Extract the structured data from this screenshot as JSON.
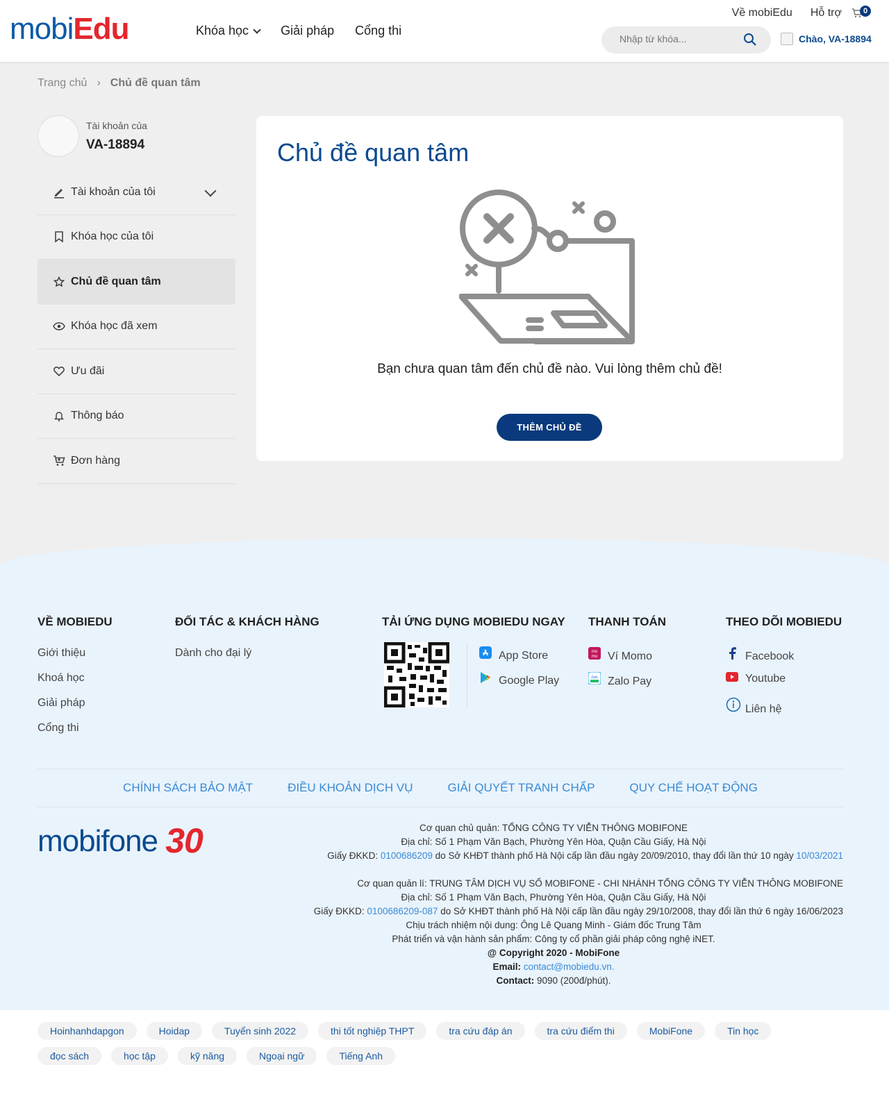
{
  "header": {
    "logo_text_a": "mobi",
    "logo_text_b": "Edu",
    "nav": [
      "Khóa học",
      "Giải pháp",
      "Cổng thi"
    ],
    "top_links": [
      "Về mobiEdu",
      "Hỗ trợ"
    ],
    "cart_count": "0",
    "search_placeholder": "Nhập từ khóa...",
    "greeting": "Chào, VA-18894"
  },
  "breadcrumb": {
    "home": "Trang chủ",
    "current": "Chủ đề quan tâm"
  },
  "profile": {
    "label": "Tài khoản của",
    "name": "VA-18894"
  },
  "menu": [
    {
      "label": "Tài khoản của tôi",
      "icon": "pencil-icon"
    },
    {
      "label": "Khóa học của tôi",
      "icon": "bookmark-icon"
    },
    {
      "label": "Chủ đề quan tâm",
      "icon": "star-icon"
    },
    {
      "label": "Khóa học đã xem",
      "icon": "eye-icon"
    },
    {
      "label": "Ưu đãi",
      "icon": "heart-icon"
    },
    {
      "label": "Thông báo",
      "icon": "bell-icon"
    },
    {
      "label": "Đơn hàng",
      "icon": "cart-icon"
    }
  ],
  "main": {
    "title": "Chủ đề quan tâm",
    "empty_message": "Bạn chưa quan tâm đến chủ đề nào. Vui lòng thêm chủ đề!",
    "button": "THÊM CHỦ ĐỀ"
  },
  "footer": {
    "col1": {
      "title": "VỀ MOBIEDU",
      "links": [
        "Giới thiệu",
        "Khoá học",
        "Giải pháp",
        "Cổng thi"
      ]
    },
    "col2": {
      "title": "ĐỐI TÁC & KHÁCH HÀNG",
      "links": [
        "Dành cho đại lý"
      ]
    },
    "col3": {
      "title": "TẢI ỨNG DỤNG MOBIEDU NGAY",
      "links": [
        "App Store",
        "Google Play"
      ]
    },
    "col4": {
      "title": "THANH TOÁN",
      "links": [
        "Ví Momo",
        "Zalo Pay"
      ]
    },
    "col5": {
      "title": "THEO DÕI MOBIEDU",
      "links": [
        "Facebook",
        "Youtube",
        "Liên hệ"
      ]
    },
    "policies": [
      "CHÍNH SÁCH BẢO MẬT",
      "ĐIỀU KHOẢN DỊCH VỤ",
      "GIẢI QUYẾT TRANH CHẤP",
      "QUY CHẾ HOẠT ĐỘNG"
    ],
    "mf_logo": "mobifone",
    "mf_30": "30",
    "legal": {
      "l1": "Cơ quan chủ quản: TỔNG CÔNG TY VIỄN THÔNG MOBIFONE",
      "l2": "Địa chỉ: Số 1 Phạm Văn Bạch, Phường Yên Hòa, Quận Cầu Giấy, Hà Nội",
      "l3a": "Giấy ĐKKD: ",
      "l3b": "0100686209",
      "l3c": " do Sở KHĐT thành phố Hà Nội cấp lần đầu ngày 20/09/2010, thay đổi lần thứ 10 ngày ",
      "l3d": "10/03/2021",
      "l4": "Cơ quan quản lí: TRUNG TÂM DỊCH VỤ SỐ MOBIFONE - CHI NHÁNH TỔNG CÔNG TY VIỄN THÔNG MOBIFONE",
      "l5": "Địa chỉ: Số 1 Phạm Văn Bạch, Phường Yên Hòa, Quận Cầu Giấy, Hà Nội",
      "l6a": "Giấy ĐKKD: ",
      "l6b": "0100686209-087",
      "l6c": " do Sở KHĐT thành phố Hà Nội cấp lần đầu ngày 29/10/2008, thay đổi lần thứ 6 ngày 16/06/2023",
      "l7": "Chịu trách nhiệm nội dung: Ông Lê Quang Minh - Giám đốc Trung Tâm",
      "l8": "Phát triển và vận hành sản phẩm: Công ty cổ phần giải pháp công nghệ iNET.",
      "l9": "@ Copyright 2020 - MobiFone",
      "l10a": "Email: ",
      "l10b": "contact@mobiedu.vn.",
      "l11a": "Contact: ",
      "l11b": "9090 (200đ/phút)."
    }
  },
  "tags": [
    "Hoinhanhdapgon",
    "Hoidap",
    "Tuyển sinh 2022",
    "thi tốt nghiệp THPT",
    "tra cứu đáp án",
    "tra cứu điểm thi",
    "MobiFone",
    "Tin học",
    "đọc sách",
    "học tập",
    "kỹ năng",
    "Ngoại ngữ",
    "Tiếng Anh"
  ]
}
